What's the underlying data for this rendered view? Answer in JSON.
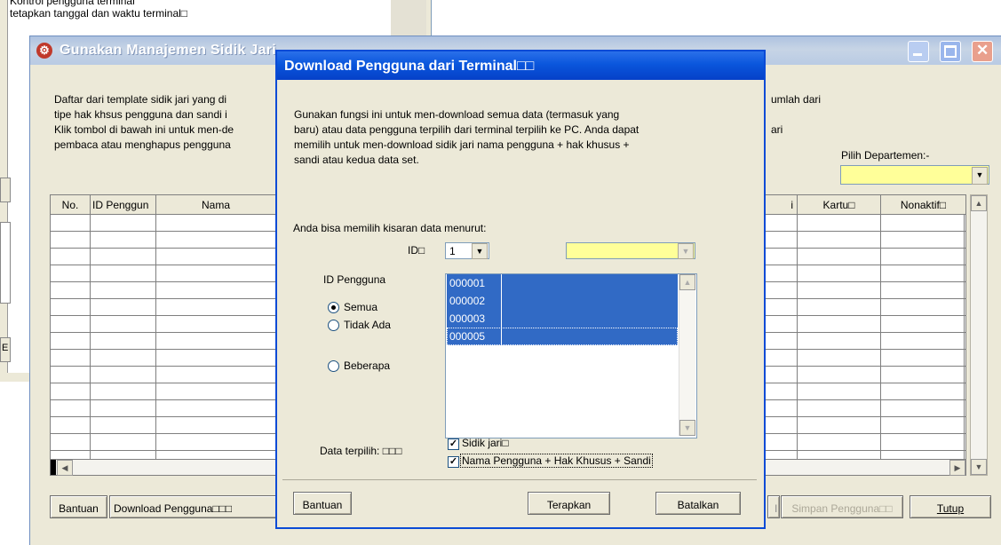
{
  "background_window": {
    "line1": "Kontrol pengguna terminal",
    "line2": "tetapkan tanggal dan waktu terminal□",
    "left_button_label": "E"
  },
  "main_window": {
    "title": "Gunakan Manajemen Sidik Jari",
    "description": [
      "Daftar dari template sidik jari yang di",
      "tipe hak khsus pengguna dan sandi i",
      "Klik tombol di bawah ini untuk men-de",
      "pembaca atau menghapus pengguna"
    ],
    "description_right": [
      "umlah dari",
      "ari"
    ],
    "department_label": "Pilih Departemen:-",
    "department_value": "",
    "table_columns": [
      "No.",
      "ID Penggun",
      "Nama",
      "i",
      "Kartu□",
      "Nonaktif□"
    ],
    "buttons": {
      "help": "Bantuan",
      "download": "Download Pengguna□□□",
      "save_partial": "l",
      "save": "Simpan Pengguna□□",
      "close": "Tutup"
    },
    "colors": {
      "title_bar": "#7ba2e7",
      "department_combo": "#ffff99"
    }
  },
  "dialog": {
    "title": "Download Pengguna dari Terminal□□",
    "description": [
      "Gunakan fungsi ini untuk men-download semua data (termasuk yang",
      "baru) atau data pengguna terpilih dari terminal terpilih ke PC. Anda dapat",
      "memilih untuk men-download sidik jari nama pengguna + hak khusus +",
      "sandi atau kedua data set."
    ],
    "range_label": "Anda bisa memilih kisaran data menurut:",
    "id_label": "ID□",
    "id_value": "1",
    "user_id_label": "ID Pengguna",
    "radios": [
      {
        "label": "Semua",
        "checked": true
      },
      {
        "label": "Tidak Ada",
        "checked": false
      },
      {
        "label": "Beberapa",
        "checked": false
      }
    ],
    "user_ids": [
      "000001",
      "000002",
      "000003",
      "000005"
    ],
    "selected_data_label": "Data terpilih: □□□",
    "checkboxes": [
      {
        "label": "Sidik jari□",
        "checked": true
      },
      {
        "label": "Nama Pengguna + Hak Khusus + Sandi",
        "checked": true
      }
    ],
    "buttons": {
      "help": "Bantuan",
      "apply": "Terapkan",
      "cancel": "Batalkan"
    },
    "colors": {
      "title_bar": "#0a56dc",
      "selection": "#316ac5",
      "combo_yellow": "#ffff99"
    }
  }
}
